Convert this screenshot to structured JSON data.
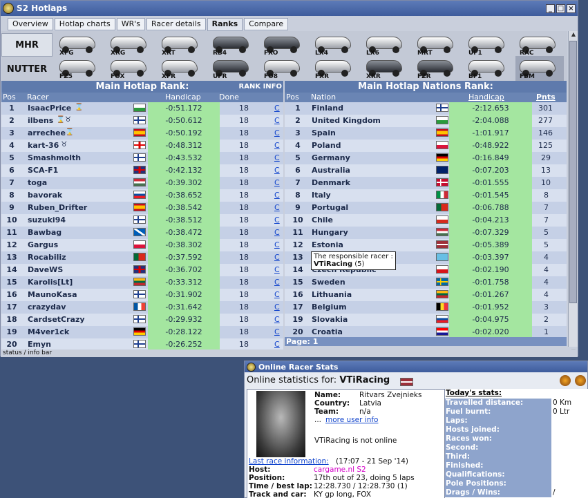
{
  "window": {
    "title": "S2 Hotlaps"
  },
  "tabs": [
    "Overview",
    "Hotlap charts",
    "WR's",
    "Racer details",
    "Ranks",
    "Compare"
  ],
  "modes": {
    "mhr": "MHR",
    "nutter": "NUTTER"
  },
  "cars_top": [
    "XFG",
    "XRG",
    "XRT",
    "RB4",
    "FXO",
    "LX4",
    "LX6",
    "MRT",
    "UF1",
    "RAC"
  ],
  "cars_bottom": [
    "FZ5",
    "FOX",
    "XFR",
    "UFR",
    "FO8",
    "FXR",
    "XRR",
    "FZR",
    "BF1",
    "FBM"
  ],
  "left": {
    "title": "Main Hotlap Rank:",
    "rank_info": "RANK INFO",
    "headers": {
      "pos": "Pos",
      "racer": "Racer",
      "handicap": "Handicap",
      "done": "Done"
    },
    "rows": [
      {
        "pos": "1",
        "name": "IsaacPrice",
        "icon": "⌛",
        "flag": "wales",
        "hc": "-0:51.172",
        "done": "18",
        "link": "C"
      },
      {
        "pos": "2",
        "name": "ilbens",
        "icon": "⌛♉",
        "flag": "fi",
        "hc": "-0:50.612",
        "done": "18",
        "link": "C"
      },
      {
        "pos": "3",
        "name": "arrechee",
        "icon": "⌛",
        "flag": "es",
        "hc": "-0:50.192",
        "done": "18",
        "link": "C"
      },
      {
        "pos": "4",
        "name": "kart-36",
        "icon": "♉",
        "flag": "en",
        "hc": "-0:48.312",
        "done": "18",
        "link": "C"
      },
      {
        "pos": "5",
        "name": "Smashmolth",
        "icon": "",
        "flag": "fi",
        "hc": "-0:43.532",
        "done": "18",
        "link": "C"
      },
      {
        "pos": "6",
        "name": "SCA-F1",
        "icon": "",
        "flag": "gb",
        "hc": "-0:42.132",
        "done": "18",
        "link": "C"
      },
      {
        "pos": "7",
        "name": "toga",
        "icon": "",
        "flag": "hu",
        "hc": "-0:39.302",
        "done": "18",
        "link": "C"
      },
      {
        "pos": "8",
        "name": "bavorak",
        "icon": "",
        "flag": "sk",
        "hc": "-0:38.652",
        "done": "18",
        "link": "C"
      },
      {
        "pos": "9",
        "name": "Ruben_Drifter",
        "icon": "",
        "flag": "es",
        "hc": "-0:38.542",
        "done": "18",
        "link": "C"
      },
      {
        "pos": "10",
        "name": "suzuki94",
        "icon": "",
        "flag": "fi",
        "hc": "-0:38.512",
        "done": "18",
        "link": "C"
      },
      {
        "pos": "11",
        "name": "Bawbag",
        "icon": "",
        "flag": "sc",
        "hc": "-0:38.472",
        "done": "18",
        "link": "C"
      },
      {
        "pos": "12",
        "name": "Gargus",
        "icon": "",
        "flag": "pl",
        "hc": "-0:38.302",
        "done": "18",
        "link": "C"
      },
      {
        "pos": "13",
        "name": "Rocabiliz",
        "icon": "",
        "flag": "pt",
        "hc": "-0:37.592",
        "done": "18",
        "link": "C"
      },
      {
        "pos": "14",
        "name": "DaveWS",
        "icon": "",
        "flag": "gb",
        "hc": "-0:36.702",
        "done": "18",
        "link": "C"
      },
      {
        "pos": "15",
        "name": "Karolis[Lt]",
        "icon": "",
        "flag": "lt",
        "hc": "-0:33.312",
        "done": "18",
        "link": "C"
      },
      {
        "pos": "16",
        "name": "MaunoKasa",
        "icon": "",
        "flag": "fi",
        "hc": "-0:31.902",
        "done": "18",
        "link": "C"
      },
      {
        "pos": "17",
        "name": "crazydav",
        "icon": "",
        "flag": "fr",
        "hc": "-0:31.642",
        "done": "18",
        "link": "C"
      },
      {
        "pos": "18",
        "name": "CardsetCrazy",
        "icon": "",
        "flag": "fi",
        "hc": "-0:29.932",
        "done": "18",
        "link": "C"
      },
      {
        "pos": "19",
        "name": "M4ver1ck",
        "icon": "",
        "flag": "de",
        "hc": "-0:28.122",
        "done": "18",
        "link": "C"
      },
      {
        "pos": "20",
        "name": "Emyn",
        "icon": "",
        "flag": "fi",
        "hc": "-0:26.252",
        "done": "18",
        "link": "C"
      }
    ]
  },
  "right": {
    "title": "Main Hotlap Nations Rank:",
    "headers": {
      "pos": "Pos",
      "nation": "Nation",
      "handicap": "Handicap",
      "pnts": "Pnts"
    },
    "rows": [
      {
        "pos": "1",
        "nation": "Finland",
        "flag": "fi",
        "hc": "-2:12.653",
        "pnts": "301"
      },
      {
        "pos": "2",
        "nation": "United Kingdom",
        "flag": "wales",
        "hc": "-2:04.088",
        "pnts": "277"
      },
      {
        "pos": "3",
        "nation": "Spain",
        "flag": "es",
        "hc": "-1:01.917",
        "pnts": "146"
      },
      {
        "pos": "4",
        "nation": "Poland",
        "flag": "pl",
        "hc": "-0:48.922",
        "pnts": "125"
      },
      {
        "pos": "5",
        "nation": "Germany",
        "flag": "de",
        "hc": "-0:16.849",
        "pnts": "29"
      },
      {
        "pos": "6",
        "nation": "Australia",
        "flag": "au",
        "hc": "-0:07.203",
        "pnts": "13"
      },
      {
        "pos": "7",
        "nation": "Denmark",
        "flag": "dk",
        "hc": "-0:01.555",
        "pnts": "10"
      },
      {
        "pos": "8",
        "nation": "Italy",
        "flag": "it",
        "hc": "-0:01.545",
        "pnts": "8"
      },
      {
        "pos": "9",
        "nation": "Portugal",
        "flag": "pt",
        "hc": "-0:06.788",
        "pnts": "7"
      },
      {
        "pos": "10",
        "nation": "Chile",
        "flag": "cl",
        "hc": "-0:04.213",
        "pnts": "7"
      },
      {
        "pos": "11",
        "nation": "Hungary",
        "flag": "hu",
        "hc": "-0:07.329",
        "pnts": "5"
      },
      {
        "pos": "12",
        "nation": "Estonia",
        "flag": "lv",
        "hc": "-0:05.389",
        "pnts": "5"
      },
      {
        "pos": "13",
        "nation": "",
        "flag": "fj",
        "hc": "-0:03.397",
        "pnts": "4"
      },
      {
        "pos": "14",
        "nation": "Czech Republic",
        "flag": "cz",
        "hc": "-0:02.190",
        "pnts": "4"
      },
      {
        "pos": "15",
        "nation": "Sweden",
        "flag": "se",
        "hc": "-0:01.758",
        "pnts": "4"
      },
      {
        "pos": "16",
        "nation": "Lithuania",
        "flag": "lt",
        "hc": "-0:01.267",
        "pnts": "4"
      },
      {
        "pos": "17",
        "nation": "Belgium",
        "flag": "be",
        "hc": "-0:01.952",
        "pnts": "3"
      },
      {
        "pos": "19",
        "nation": "Slovakia",
        "flag": "sk",
        "hc": "-0:04.975",
        "pnts": "2"
      },
      {
        "pos": "20",
        "nation": "Croatia",
        "flag": "hr",
        "hc": "-0:02.020",
        "pnts": "1"
      }
    ],
    "page": "Page: 1"
  },
  "tooltip": {
    "line1": "The responsible racer :",
    "name": "VTiRacing",
    "count": "(5)"
  },
  "status_bar": "status / info bar",
  "stats": {
    "title": "Online Racer Stats",
    "heading_prefix": "Online statistics for:",
    "racer": "VTiRacing",
    "name_label": "Name:",
    "name": "Ritvars Zvejnieks",
    "country_label": "Country:",
    "country": "Latvia",
    "team_label": "Team:",
    "team": "n/a",
    "more": "more user info",
    "more_prefix": "...",
    "online_status": "VTiRacing is not online",
    "last_race_label": "Last race information:",
    "last_race_date": "(17:07 - 21 Sep '14)",
    "host_label": "Host:",
    "host": "cargame.nl S2",
    "position_label": "Position:",
    "position": "17th out of 23, doing 5 laps",
    "time_label": "Time / best lap:",
    "time": "12:28.730 / 12:28.730 (1)",
    "track_label": "Track and car:",
    "track": "KY gp long, FOX",
    "today_title": "Today's stats:",
    "today": [
      {
        "k": "Travelled distance:",
        "v": "0 Km"
      },
      {
        "k": "Fuel burnt:",
        "v": "0 Ltr"
      },
      {
        "k": "Laps:",
        "v": ""
      },
      {
        "k": "Hosts joined:",
        "v": ""
      },
      {
        "k": "Races won:",
        "v": ""
      },
      {
        "k": "Second:",
        "v": ""
      },
      {
        "k": "Third:",
        "v": ""
      },
      {
        "k": "Finished:",
        "v": ""
      },
      {
        "k": "Qualifications:",
        "v": ""
      },
      {
        "k": "Pole Positions:",
        "v": ""
      },
      {
        "k": "Drags / Wins:",
        "v": "/"
      }
    ]
  },
  "colors": {
    "handicap_bg": "#a4e6a0",
    "row_a": "#c5d0e6",
    "row_b": "#d8e0ef",
    "header": "#5e7aac",
    "link": "#1144cc"
  }
}
